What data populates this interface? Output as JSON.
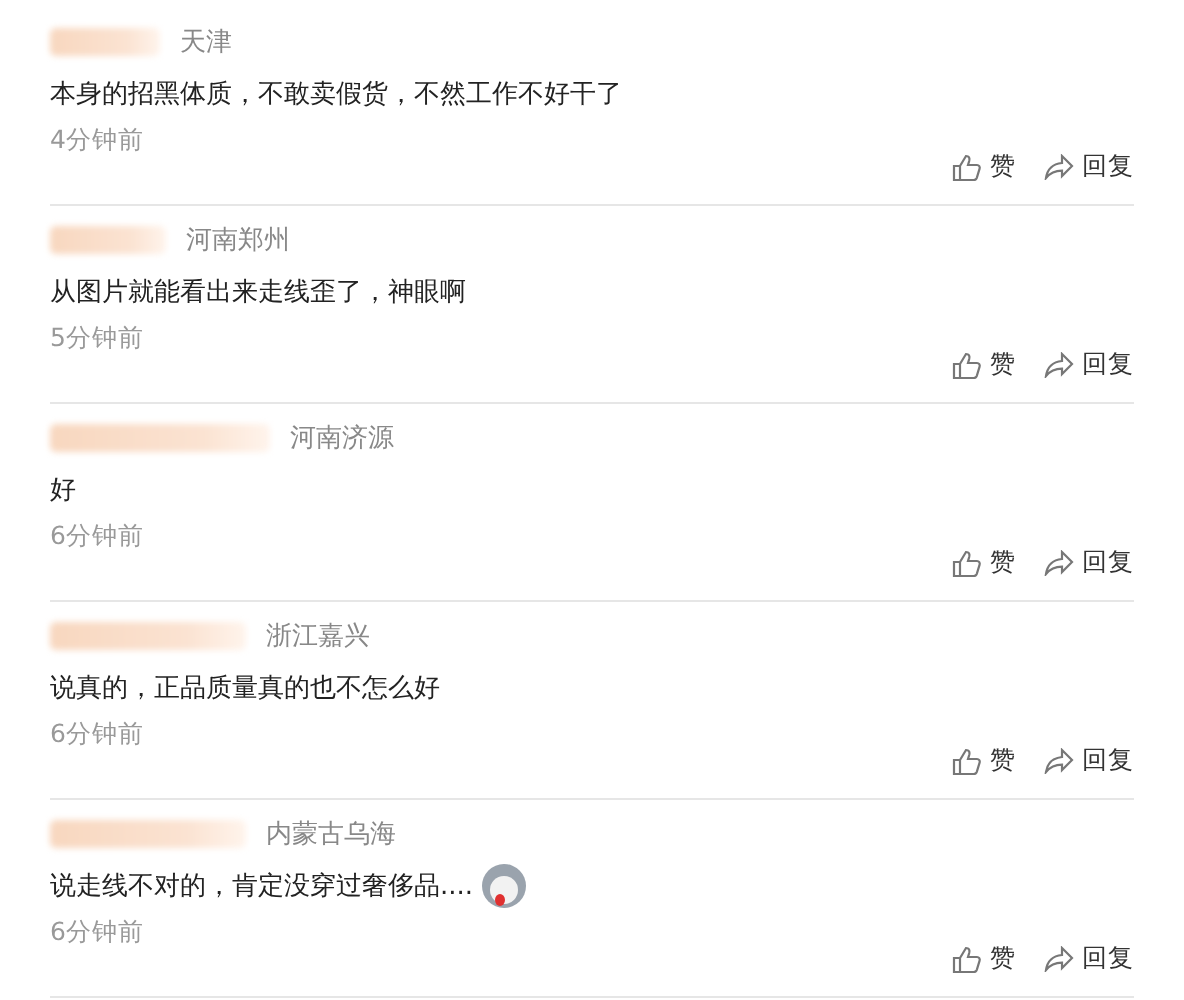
{
  "comments": [
    {
      "location": "天津",
      "text": "本身的招黑体质，不敢卖假货，不然工作不好干了",
      "time": "4分钟前",
      "like": "赞",
      "reply": "回复",
      "emoji": false
    },
    {
      "location": "河南郑州",
      "text": "从图片就能看出来走线歪了，神眼啊",
      "time": "5分钟前",
      "like": "赞",
      "reply": "回复",
      "emoji": false
    },
    {
      "location": "河南济源",
      "text": "好",
      "time": "6分钟前",
      "like": "赞",
      "reply": "回复",
      "emoji": false
    },
    {
      "location": "浙江嘉兴",
      "text": "说真的，正品质量真的也不怎么好",
      "time": "6分钟前",
      "like": "赞",
      "reply": "回复",
      "emoji": false
    },
    {
      "location": "内蒙古乌海",
      "text": "说走线不对的，肯定没穿过奢侈品....",
      "time": "6分钟前",
      "like": "赞",
      "reply": "回复",
      "emoji": true
    }
  ]
}
